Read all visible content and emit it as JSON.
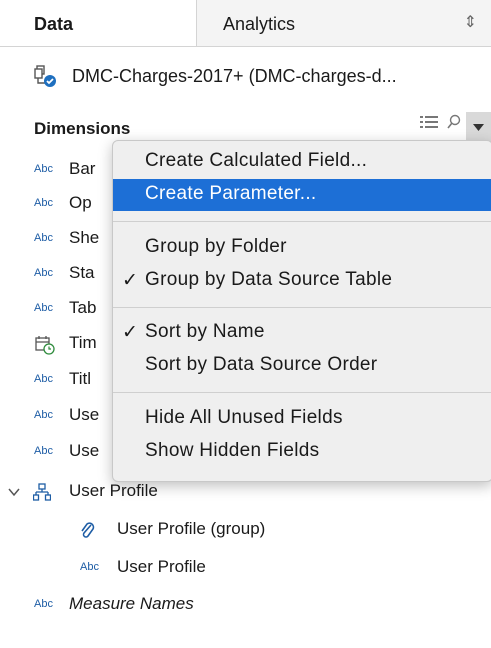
{
  "tabs": {
    "data": "Data",
    "analytics": "Analytics"
  },
  "source": {
    "label": "DMC-Charges-2017+ (DMC-charges-d...",
    "icon": "datasource-icon"
  },
  "dimensions": {
    "header": "Dimensions",
    "items": [
      {
        "type": "Abc",
        "label": "Bar"
      },
      {
        "type": "Abc",
        "label": "Op"
      },
      {
        "type": "Abc",
        "label": "She"
      },
      {
        "type": "Abc",
        "label": "Sta"
      },
      {
        "type": "Abc",
        "label": "Tab"
      },
      {
        "type": "date",
        "label": "Tim"
      },
      {
        "type": "Abc",
        "label": "Titl"
      },
      {
        "type": "Abc",
        "label": "Use"
      },
      {
        "type": "Abc",
        "label": "Use"
      }
    ],
    "folder": {
      "label": "User Profile"
    },
    "group": {
      "label": "User Profile (group)"
    },
    "sub_item": {
      "type": "Abc",
      "label": "User Profile"
    },
    "measure_names": {
      "type": "Abc",
      "label": "Measure Names"
    }
  },
  "menu": {
    "items": [
      {
        "label": "Create Calculated Field...",
        "checked": false
      },
      {
        "label": "Create Parameter...",
        "checked": false,
        "highlighted": true
      },
      {
        "label": "Group by Folder",
        "checked": false
      },
      {
        "label": "Group by Data Source Table",
        "checked": true
      },
      {
        "label": "Sort by Name",
        "checked": true
      },
      {
        "label": "Sort by Data Source Order",
        "checked": false
      },
      {
        "label": "Hide All Unused Fields",
        "checked": false
      },
      {
        "label": "Show Hidden Fields",
        "checked": false
      }
    ],
    "check_glyph": "✓"
  },
  "colors": {
    "highlight": "#1d6fd6",
    "abc": "#1e5da5",
    "accent_green": "#2e8b3c"
  }
}
